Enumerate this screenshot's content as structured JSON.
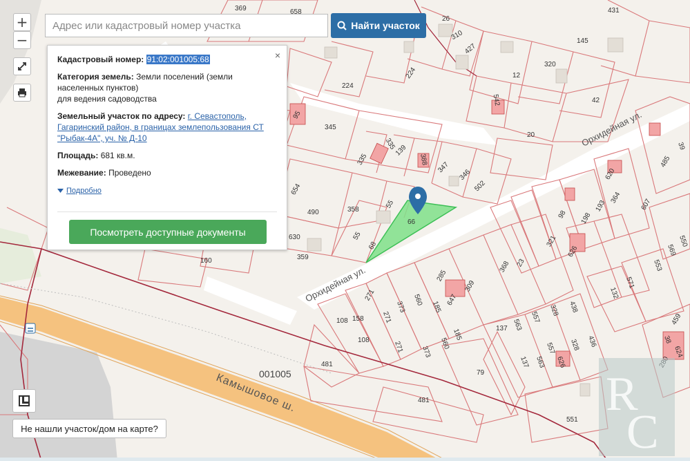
{
  "map": {
    "block_number": "001005",
    "streets": [
      "Орхидейная ул.",
      "Орхидейная ул.",
      "Камышовое ш."
    ],
    "parcel_labels": [
      "369",
      "658",
      "26",
      "431",
      "310",
      "427",
      "145",
      "224",
      "224",
      "12",
      "320",
      "542",
      "345",
      "42",
      "20",
      "335",
      "335",
      "139",
      "388",
      "347",
      "346",
      "502",
      "654",
      "490",
      "358",
      "55",
      "55",
      "66",
      "68",
      "630",
      "359",
      "160",
      "98",
      "198",
      "193",
      "364",
      "607",
      "485",
      "620",
      "626",
      "321",
      "368",
      "23",
      "285",
      "309",
      "185",
      "560",
      "373",
      "271",
      "271",
      "158",
      "108",
      "108",
      "271",
      "373",
      "560",
      "185",
      "481",
      "137",
      "563",
      "557",
      "378",
      "438",
      "436",
      "328",
      "557",
      "563",
      "137",
      "79",
      "481",
      "571",
      "553",
      "569",
      "550",
      "132",
      "459",
      "38",
      "624",
      "280",
      "551",
      "39",
      "626",
      "647",
      "95"
    ],
    "selected_parcel": "66",
    "colors": {
      "parcel_line": "#d9787a",
      "building": "#f2a5a5",
      "selected_fill": "#7fe08a",
      "road_major": "#f5c27f",
      "pin": "#2d6ea6"
    }
  },
  "controls": {
    "zoom_in": "+",
    "zoom_out": "−",
    "fullscreen_icon": "expand-icon",
    "print_icon": "printer-icon",
    "layers_icon": "layers-icon"
  },
  "search": {
    "placeholder": "Адрес или кадастровый номер участка",
    "button_label": "Найти участок"
  },
  "popup": {
    "cadastral_label": "Кадастровый номер:",
    "cadastral_value": "91:02:001005:68",
    "category_label": "Категория земель:",
    "category_value": "Земли поселений (земли населенных пунктов)",
    "category_use": "для ведения садоводства",
    "address_label": "Земельный участок по адресу:",
    "address_value": "г. Севастополь, Гагаринский район, в границах землепользования СТ \"Рыбак-4А\", уч. № Д-10",
    "area_label": "Площадь:",
    "area_value": "681 кв.м.",
    "survey_label": "Межевание:",
    "survey_value": "Проведено",
    "more_link": "Подробно",
    "docs_button": "Посмотреть доступные документы",
    "close": "×"
  },
  "not_found_button": "Не нашли участок/дом на карте?"
}
